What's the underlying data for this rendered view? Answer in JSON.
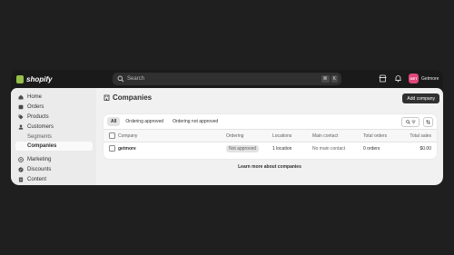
{
  "topbar": {
    "logo_text": "shopify",
    "search_placeholder": "Search",
    "shortcut_keys": [
      "⌘",
      "K"
    ],
    "store_initials": "GET",
    "store_name": "Getmore",
    "icons": [
      "store-icon",
      "bell-icon"
    ]
  },
  "sidebar": {
    "items": [
      {
        "label": "Home",
        "icon": "home-icon"
      },
      {
        "label": "Orders",
        "icon": "inbox-icon"
      },
      {
        "label": "Products",
        "icon": "tag-icon"
      },
      {
        "label": "Customers",
        "icon": "person-icon"
      },
      {
        "label": "Segments",
        "icon": ""
      },
      {
        "label": "Companies",
        "icon": ""
      },
      {
        "label": "Marketing",
        "icon": "target-icon"
      },
      {
        "label": "Discounts",
        "icon": "discount-icon"
      },
      {
        "label": "Content",
        "icon": "document-icon"
      }
    ]
  },
  "page": {
    "title": "Companies",
    "add_button": "Add company"
  },
  "tabs": [
    "All",
    "Ordering approved",
    "Ordering not approved"
  ],
  "table": {
    "columns": [
      "Company",
      "Ordering",
      "Locations",
      "Main contact",
      "Total orders",
      "Total sales"
    ],
    "rows": [
      {
        "company": "getmore",
        "ordering": "Not approved",
        "locations": "1 location",
        "main_contact": "No main contact",
        "total_orders": "0 orders",
        "total_sales": "$0.00"
      }
    ]
  },
  "learn_more": "Learn more about companies",
  "colors": {
    "accent": "#303030",
    "avatar": "#e0457b",
    "shopify_green": "#95bf47"
  }
}
